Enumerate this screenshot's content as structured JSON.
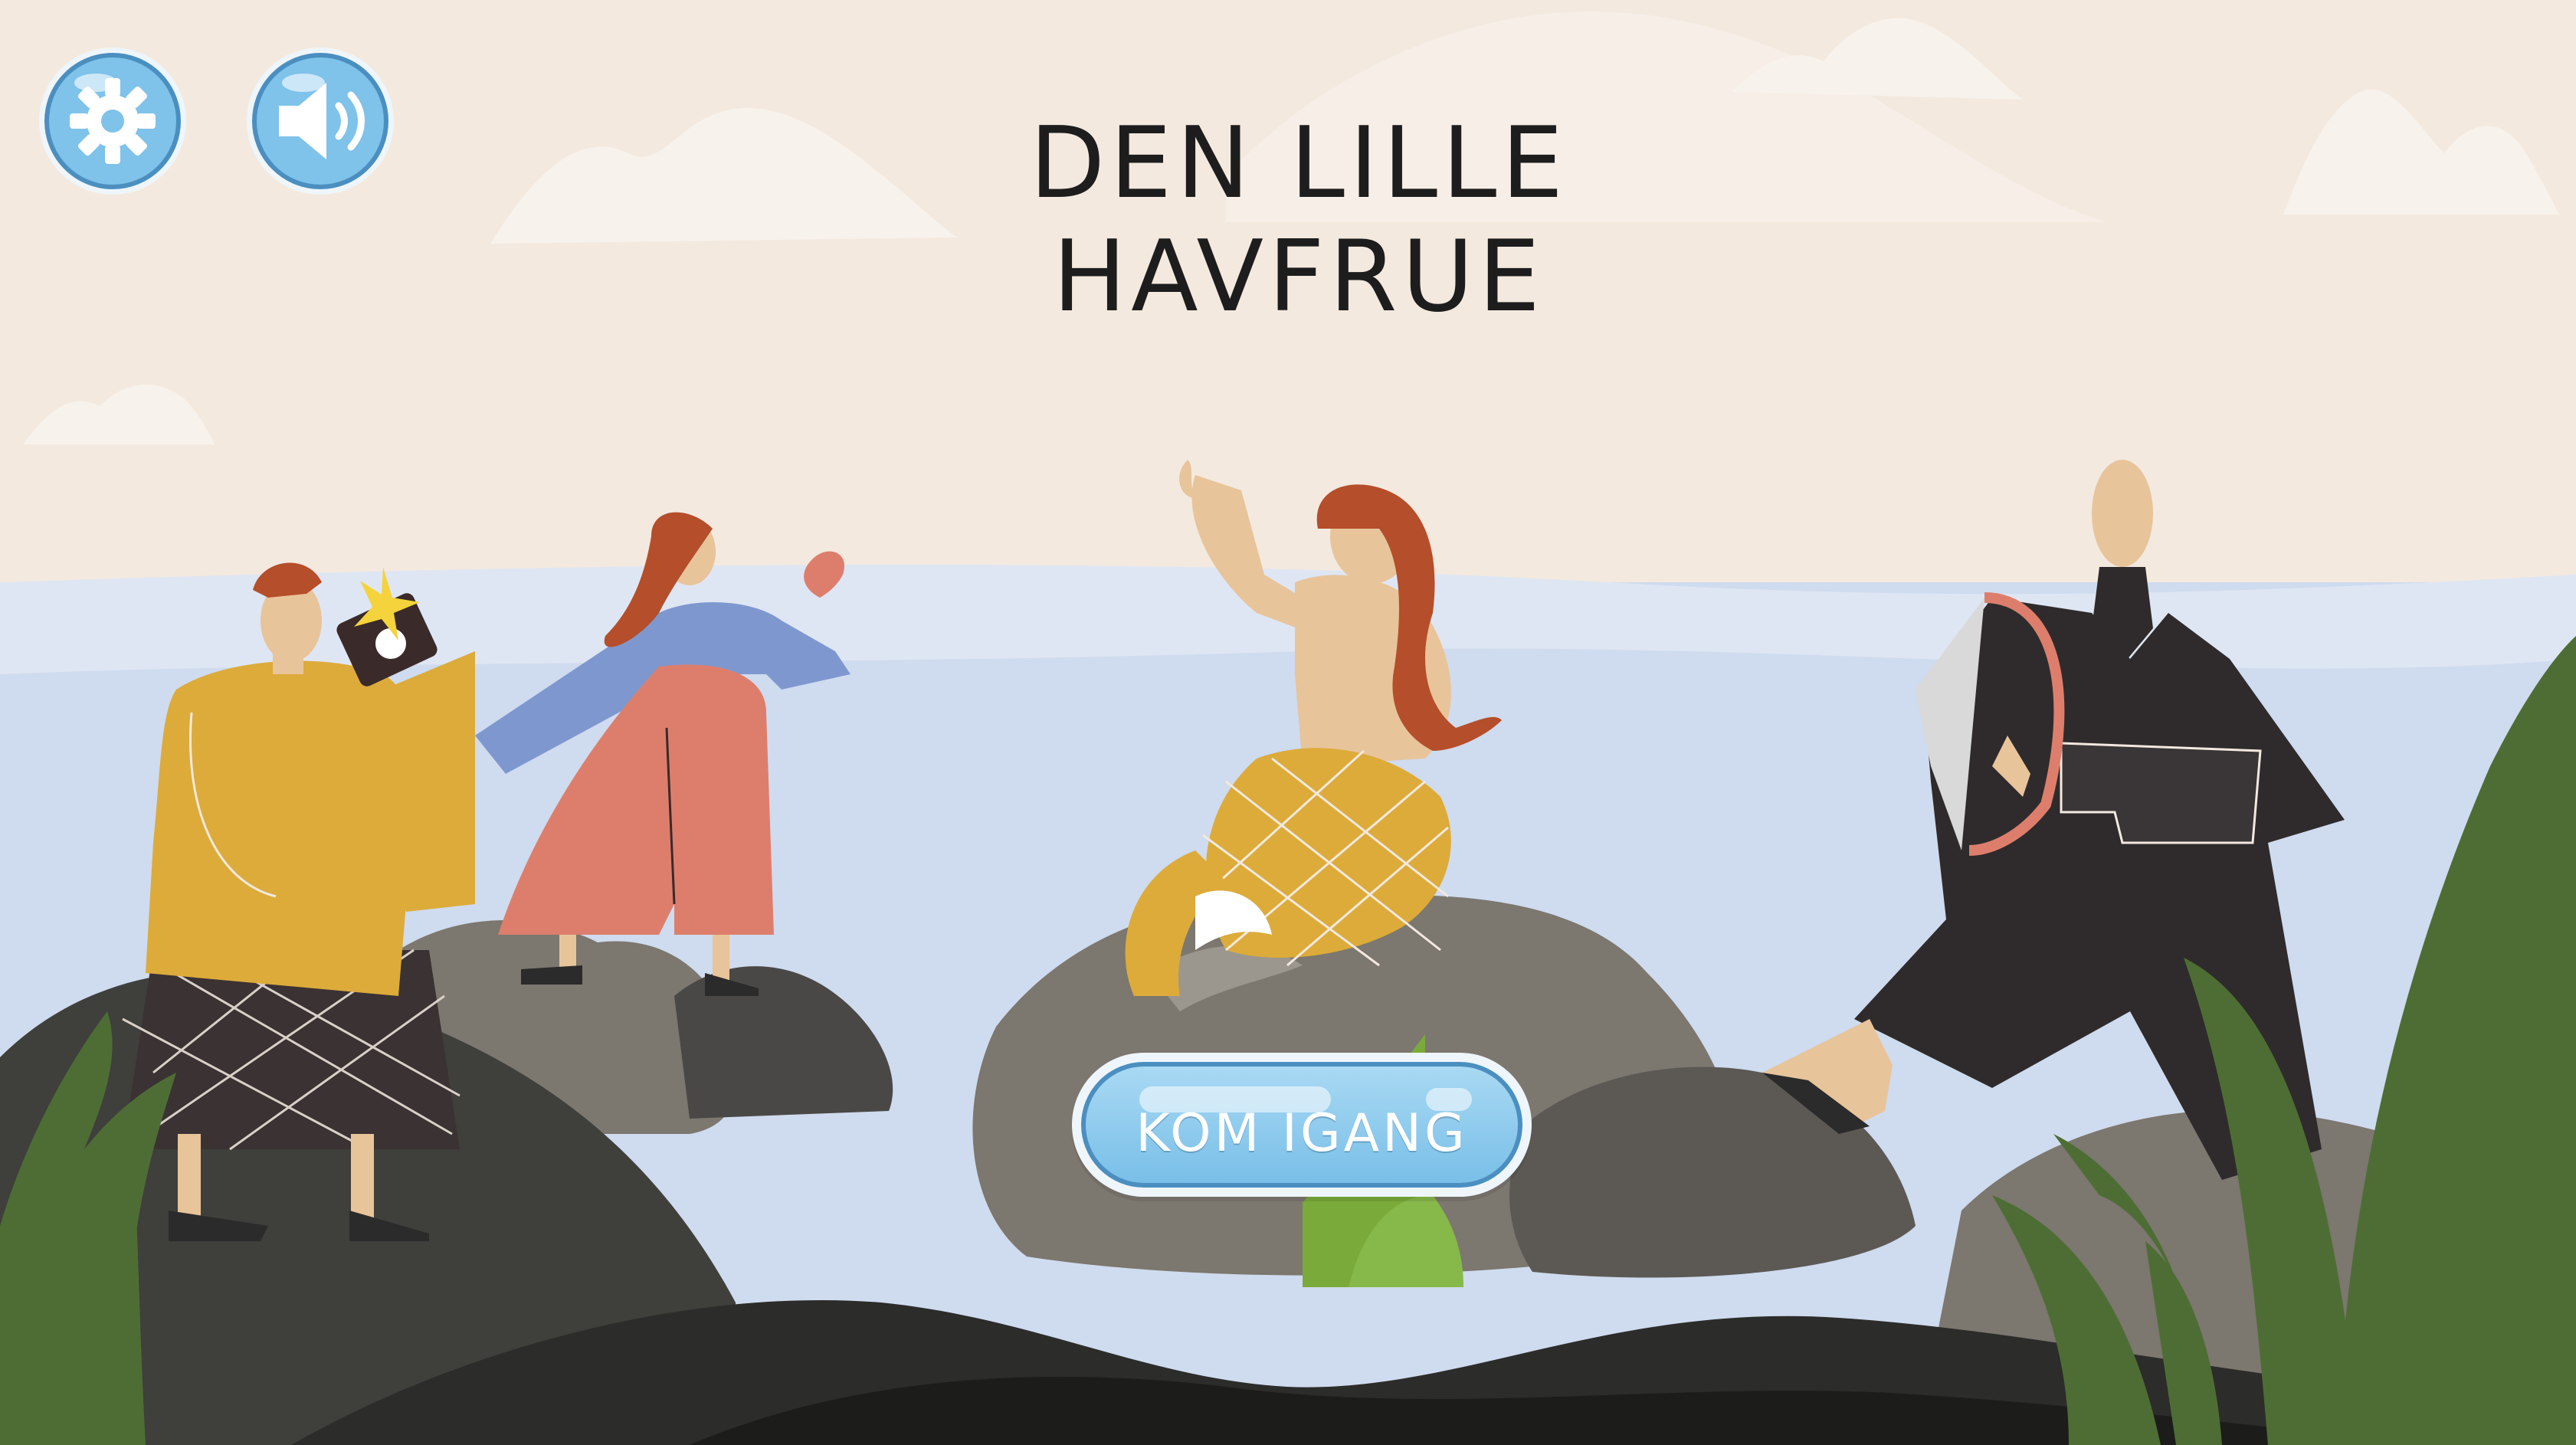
{
  "game": {
    "title_line1": "DEN LILLE",
    "title_line2": "HAVFRUE",
    "start_label": "KOM IGANG"
  },
  "controls": {
    "settings_icon": "gear-icon",
    "sound_icon": "speaker-icon"
  },
  "colors": {
    "sky": "#f3e9df",
    "sea": "#cfdbee",
    "button_blue": "#79bfe8",
    "button_border": "#4b8fc0",
    "rock_dark": "#3f3f3c",
    "rock_grey": "#7c776f",
    "grass": "#4e6d35",
    "mustard": "#dcab3a",
    "coral": "#dd7e6c",
    "robe": "#2f2b2c"
  }
}
